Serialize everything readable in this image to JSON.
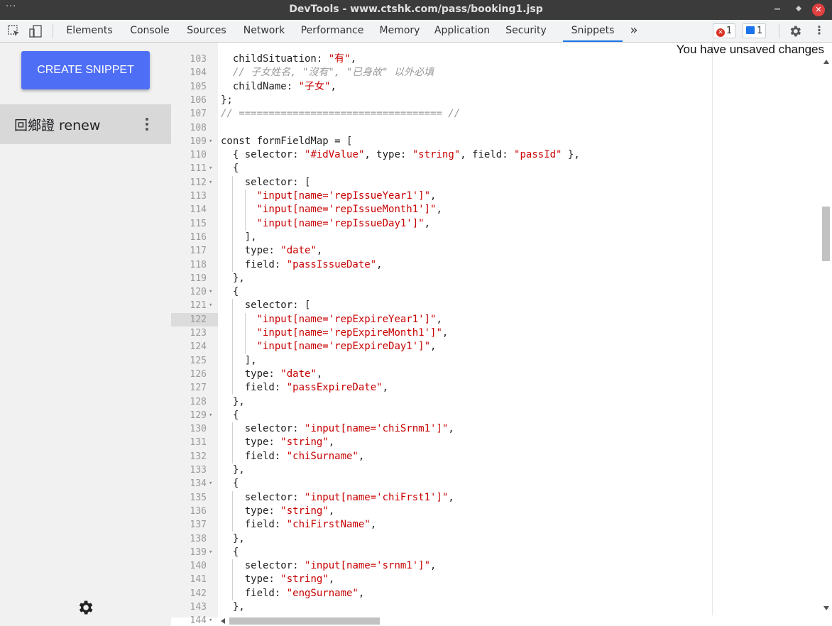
{
  "window": {
    "title": "DevTools - www.ctshk.com/pass/booking1.jsp",
    "menu_glyph": "···",
    "minimize": "‒",
    "restore": "⬩",
    "close": "✕"
  },
  "toolbar": {
    "tabs": [
      "Elements",
      "Console",
      "Sources",
      "Network",
      "Performance",
      "Memory",
      "Application",
      "Security",
      "Snippets"
    ],
    "active_tab": "Snippets",
    "more": "»",
    "error_count": "1",
    "message_count": "1",
    "kebab": "⋮"
  },
  "status": {
    "unsaved": "You have unsaved changes"
  },
  "sidebar": {
    "create_label": "CREATE SNIPPET",
    "snippet_name": "回鄉證 renew"
  },
  "editor": {
    "lines": [
      {
        "n": "103",
        "fold": false,
        "html": "  childSituation: <span class='s'>\"有\"</span>,"
      },
      {
        "n": "104",
        "fold": false,
        "html": "  <span class='c'>// 子女姓名, \"沒有\", \"已身故\" 以外必填</span>"
      },
      {
        "n": "105",
        "fold": false,
        "html": "  childName: <span class='s'>\"子女\"</span>,"
      },
      {
        "n": "106",
        "fold": false,
        "html": "};"
      },
      {
        "n": "107",
        "fold": false,
        "html": "<span class='c'>// ================================== //</span>"
      },
      {
        "n": "108",
        "fold": false,
        "html": ""
      },
      {
        "n": "109",
        "fold": true,
        "html": "const formFieldMap = ["
      },
      {
        "n": "110",
        "fold": false,
        "html": "  { selector: <span class='s'>\"#idValue\"</span>, type: <span class='s'>\"string\"</span>, field: <span class='s'>\"passId\"</span> },"
      },
      {
        "n": "111",
        "fold": true,
        "html": "  {"
      },
      {
        "n": "112",
        "fold": true,
        "html": "    selector: ["
      },
      {
        "n": "113",
        "fold": false,
        "html": "      <span class='s'>\"input[name='repIssueYear1']\"</span>,"
      },
      {
        "n": "114",
        "fold": false,
        "html": "      <span class='s'>\"input[name='repIssueMonth1']\"</span>,"
      },
      {
        "n": "115",
        "fold": false,
        "html": "      <span class='s'>\"input[name='repIssueDay1']\"</span>,"
      },
      {
        "n": "116",
        "fold": false,
        "html": "    ],"
      },
      {
        "n": "117",
        "fold": false,
        "html": "    type: <span class='s'>\"date\"</span>,"
      },
      {
        "n": "118",
        "fold": false,
        "html": "    field: <span class='s'>\"passIssueDate\"</span>,"
      },
      {
        "n": "119",
        "fold": false,
        "html": "  },"
      },
      {
        "n": "120",
        "fold": true,
        "html": "  {"
      },
      {
        "n": "121",
        "fold": true,
        "html": "    selector: ["
      },
      {
        "n": "122",
        "fold": false,
        "hl": true,
        "html": "      <span class='s'>\"input[name='repExpireYear1']\"</span>,"
      },
      {
        "n": "123",
        "fold": false,
        "html": "      <span class='s'>\"input[name='repExpireMonth1']\"</span>,"
      },
      {
        "n": "124",
        "fold": false,
        "html": "      <span class='s'>\"input[name='repExpireDay1']\"</span>,"
      },
      {
        "n": "125",
        "fold": false,
        "html": "    ],"
      },
      {
        "n": "126",
        "fold": false,
        "html": "    type: <span class='s'>\"date\"</span>,"
      },
      {
        "n": "127",
        "fold": false,
        "html": "    field: <span class='s'>\"passExpireDate\"</span>,"
      },
      {
        "n": "128",
        "fold": false,
        "html": "  },"
      },
      {
        "n": "129",
        "fold": true,
        "html": "  {"
      },
      {
        "n": "130",
        "fold": false,
        "html": "    selector: <span class='s'>\"input[name='chiSrnm1']\"</span>,"
      },
      {
        "n": "131",
        "fold": false,
        "html": "    type: <span class='s'>\"string\"</span>,"
      },
      {
        "n": "132",
        "fold": false,
        "html": "    field: <span class='s'>\"chiSurname\"</span>,"
      },
      {
        "n": "133",
        "fold": false,
        "html": "  },"
      },
      {
        "n": "134",
        "fold": true,
        "html": "  {"
      },
      {
        "n": "135",
        "fold": false,
        "html": "    selector: <span class='s'>\"input[name='chiFrst1']\"</span>,"
      },
      {
        "n": "136",
        "fold": false,
        "html": "    type: <span class='s'>\"string\"</span>,"
      },
      {
        "n": "137",
        "fold": false,
        "html": "    field: <span class='s'>\"chiFirstName\"</span>,"
      },
      {
        "n": "138",
        "fold": false,
        "html": "  },"
      },
      {
        "n": "139",
        "fold": true,
        "html": "  {"
      },
      {
        "n": "140",
        "fold": false,
        "html": "    selector: <span class='s'>\"input[name='srnm1']\"</span>,"
      },
      {
        "n": "141",
        "fold": false,
        "html": "    type: <span class='s'>\"string\"</span>,"
      },
      {
        "n": "142",
        "fold": false,
        "html": "    field: <span class='s'>\"engSurname\"</span>,"
      },
      {
        "n": "143",
        "fold": false,
        "html": "  },"
      },
      {
        "n": "144",
        "fold": true,
        "html": "  {"
      }
    ]
  }
}
